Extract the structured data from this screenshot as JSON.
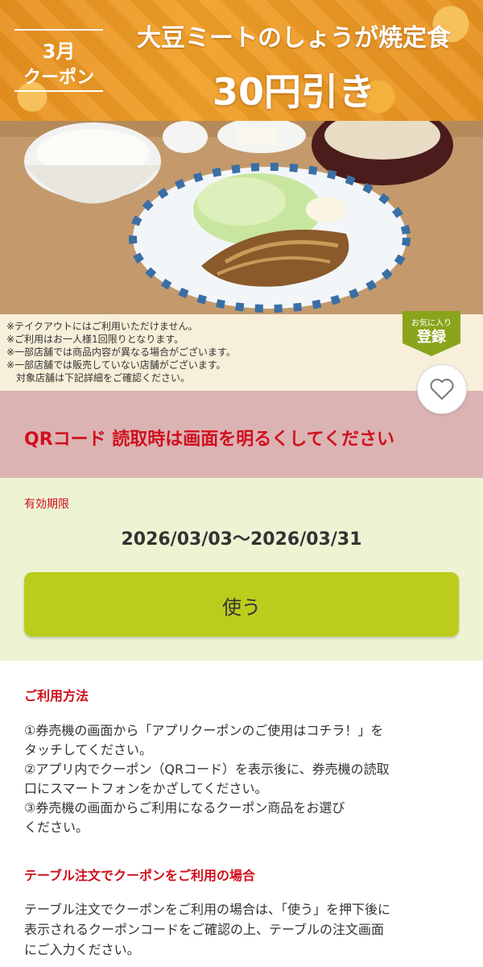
{
  "banner": {
    "month": "3月",
    "coupon_word": "クーポン",
    "title": "大豆ミートのしょうが焼定食",
    "discount": "30円引き"
  },
  "notes": [
    "※テイクアウトにはご利用いただけません。",
    "※ご利用はお一人様1回限りとなります。",
    "※一部店舗では商品内容が異なる場合がございます。",
    "※一部店舗では販売していない店舗がございます。",
    "　対象店舗は下記詳細をご確認ください。"
  ],
  "favorite_badge": {
    "small": "お気に入り",
    "big": "登録"
  },
  "alert": {
    "message": "QRコード 読取時は画面を明るくしてください"
  },
  "validity": {
    "label": "有効期限",
    "dates": "2026/03/03～2026/03/31"
  },
  "use_button": {
    "label": "使う"
  },
  "usage": {
    "title": "ご利用方法",
    "lines": [
      "①券売機の画面から「アプリクーポンのご使用はコチラ！」を",
      "タッチしてください。",
      "②アプリ内でクーポン（QRコード）を表示後に、券売機の読取",
      "口にスマートフォンをかざしてください。",
      "③券売機の画面からご利用になるクーポン商品をお選び",
      "ください。"
    ]
  },
  "table_order": {
    "title": "テーブル注文でクーポンをご利用の場合",
    "lines": [
      "テーブル注文でクーポンをご利用の場合は、「使う」を押下後に",
      "表示されるクーポンコードをご確認の上、テーブルの注文画面",
      "にご入力ください。"
    ]
  },
  "colors": {
    "accent_red": "#d0101e",
    "button_green": "#bccc1c",
    "banner_orange": "#f0a028",
    "favorite_green": "#8aa51c"
  }
}
